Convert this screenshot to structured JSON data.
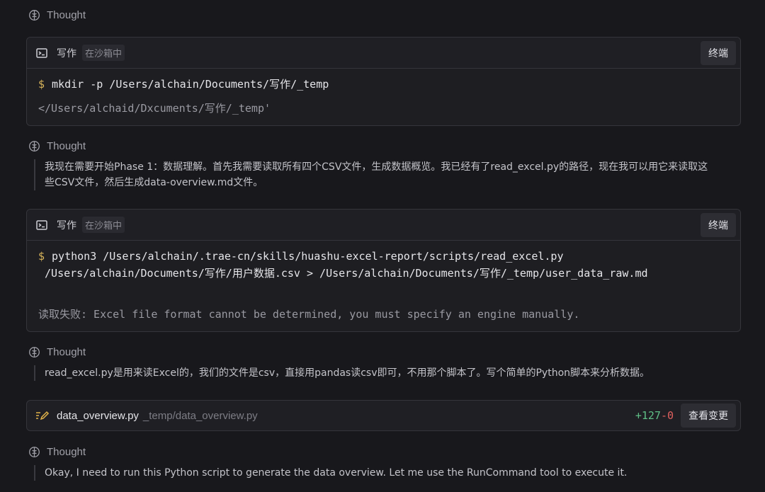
{
  "thoughts": [
    {
      "label": "Thought"
    },
    {
      "label": "Thought",
      "text": "我现在需要开始Phase 1：数据理解。首先我需要读取所有四个CSV文件，生成数据概览。我已经有了read_excel.py的路径，现在我可以用它来读取这\n些CSV文件，然后生成data-overview.md文件。"
    },
    {
      "label": "Thought",
      "text": "read_excel.py是用来读Excel的，我们的文件是csv，直接用pandas读csv即可，不用那个脚本了。写个简单的Python脚本来分析数据。"
    },
    {
      "label": "Thought",
      "text": "Okay, I need to run this Python script to generate the data overview. Let me use the RunCommand tool to execute it."
    }
  ],
  "cards": [
    {
      "icon": "terminal-icon",
      "title": "写作",
      "badge": "在沙箱中",
      "button": "终端",
      "prompt": "$",
      "command": "mkdir -p /Users/alchain/Documents/写作/_temp",
      "output": "</Users/alchaid/Dxcuments/写作/_temp'"
    },
    {
      "icon": "terminal-icon",
      "title": "写作",
      "badge": "在沙箱中",
      "button": "终端",
      "prompt": "$",
      "command": "python3 /Users/alchain/.trae-cn/skills/huashu-excel-report/scripts/read_excel.py\n /Users/alchain/Documents/写作/用户数据.csv > /Users/alchain/Documents/写作/_temp/user_data_raw.md",
      "output": "读取失败: Excel file format cannot be determined, you must specify an engine manually."
    }
  ],
  "file_change": {
    "icon": "edit-file-icon",
    "name": "data_overview.py",
    "path": "_temp/data_overview.py",
    "added": "+127",
    "removed": "-0",
    "button": "查看变更"
  },
  "colors": {
    "background": "#18181c",
    "card": "#1e1e22",
    "prompt": "#d7b35a",
    "added": "#5fbf86",
    "removed": "#e0605e",
    "edit_icon": "#e0b24a"
  }
}
